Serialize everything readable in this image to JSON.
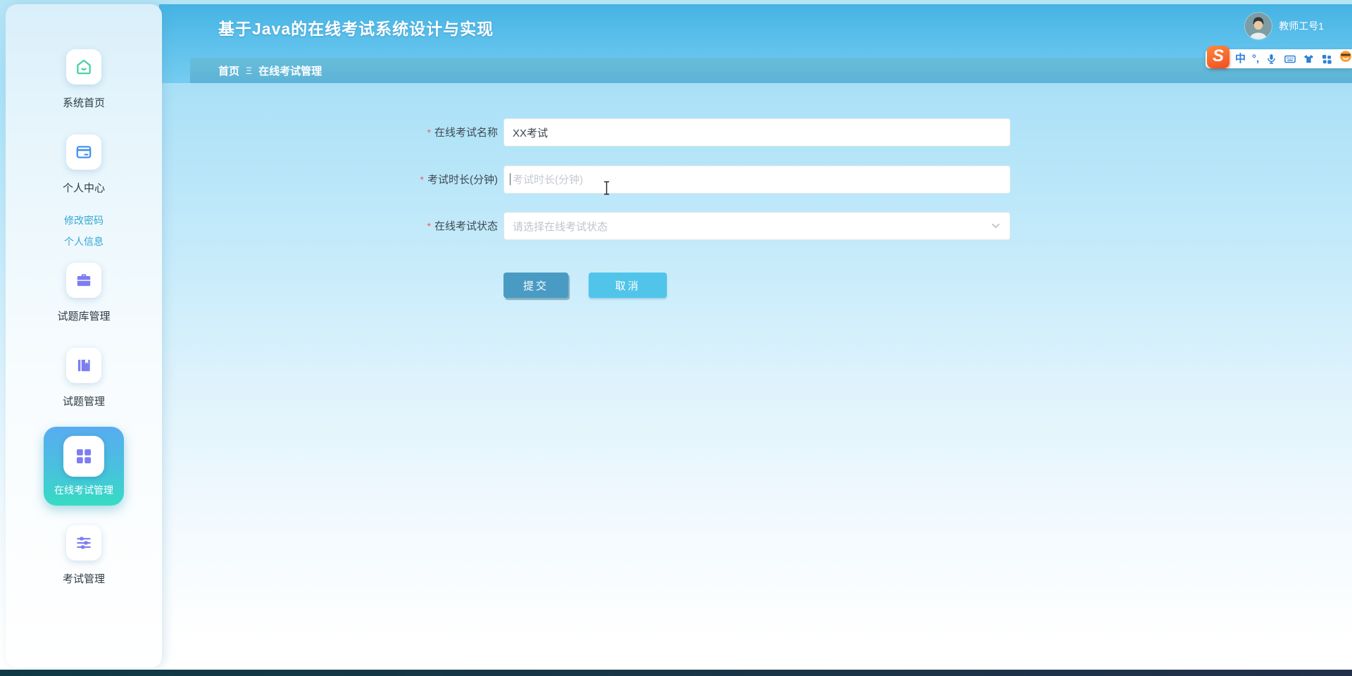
{
  "app": {
    "title": "基于Java的在线考试系统设计与实现"
  },
  "header": {
    "user": {
      "name": "教师工号1"
    },
    "breadcrumb": {
      "home": "首页",
      "separator": "Ξ",
      "current": "在线考试管理"
    }
  },
  "sidebar": {
    "items": [
      {
        "label": "系统首页",
        "icon": "home-icon"
      },
      {
        "label": "个人中心",
        "icon": "id-card-icon"
      },
      {
        "label": "试题库管理",
        "icon": "briefcase-icon"
      },
      {
        "label": "试题管理",
        "icon": "book-icon"
      },
      {
        "label": "在线考试管理",
        "icon": "grid-icon",
        "active": true
      },
      {
        "label": "考试管理",
        "icon": "sliders-icon"
      }
    ],
    "profile_links": [
      {
        "label": "修改密码"
      },
      {
        "label": "个人信息"
      }
    ]
  },
  "form": {
    "required_mark": "*",
    "fields": [
      {
        "label": "在线考试名称",
        "type": "text",
        "value": "XX考试"
      },
      {
        "label": "考试时长(分钟)",
        "type": "text",
        "placeholder": "考试时长(分钟)"
      },
      {
        "label": "在线考试状态",
        "type": "select",
        "placeholder": "请选择在线考试状态"
      }
    ],
    "submit_label": "提交",
    "cancel_label": "取消"
  },
  "ime_toolbar": {
    "brand": "S",
    "lang_mode": "中",
    "punctuation": "°,"
  },
  "colors": {
    "header_top": "#45b3e4",
    "header_bottom": "#75ccf0",
    "breadcrumb_bar": "#5cb3d5",
    "active_item_top": "#58acf0",
    "active_item_bottom": "#36dcc2",
    "submit_button": "#4a9bc4",
    "cancel_button": "#51c4ea",
    "link": "#35a7d3",
    "icon_purple": "#7d7df2",
    "icon_green": "#3fd0a2",
    "icon_blue": "#3d8cf0",
    "required": "#f05b5b",
    "ime_blue": "#2f7fd4",
    "bottom_bar": "#22304a"
  }
}
